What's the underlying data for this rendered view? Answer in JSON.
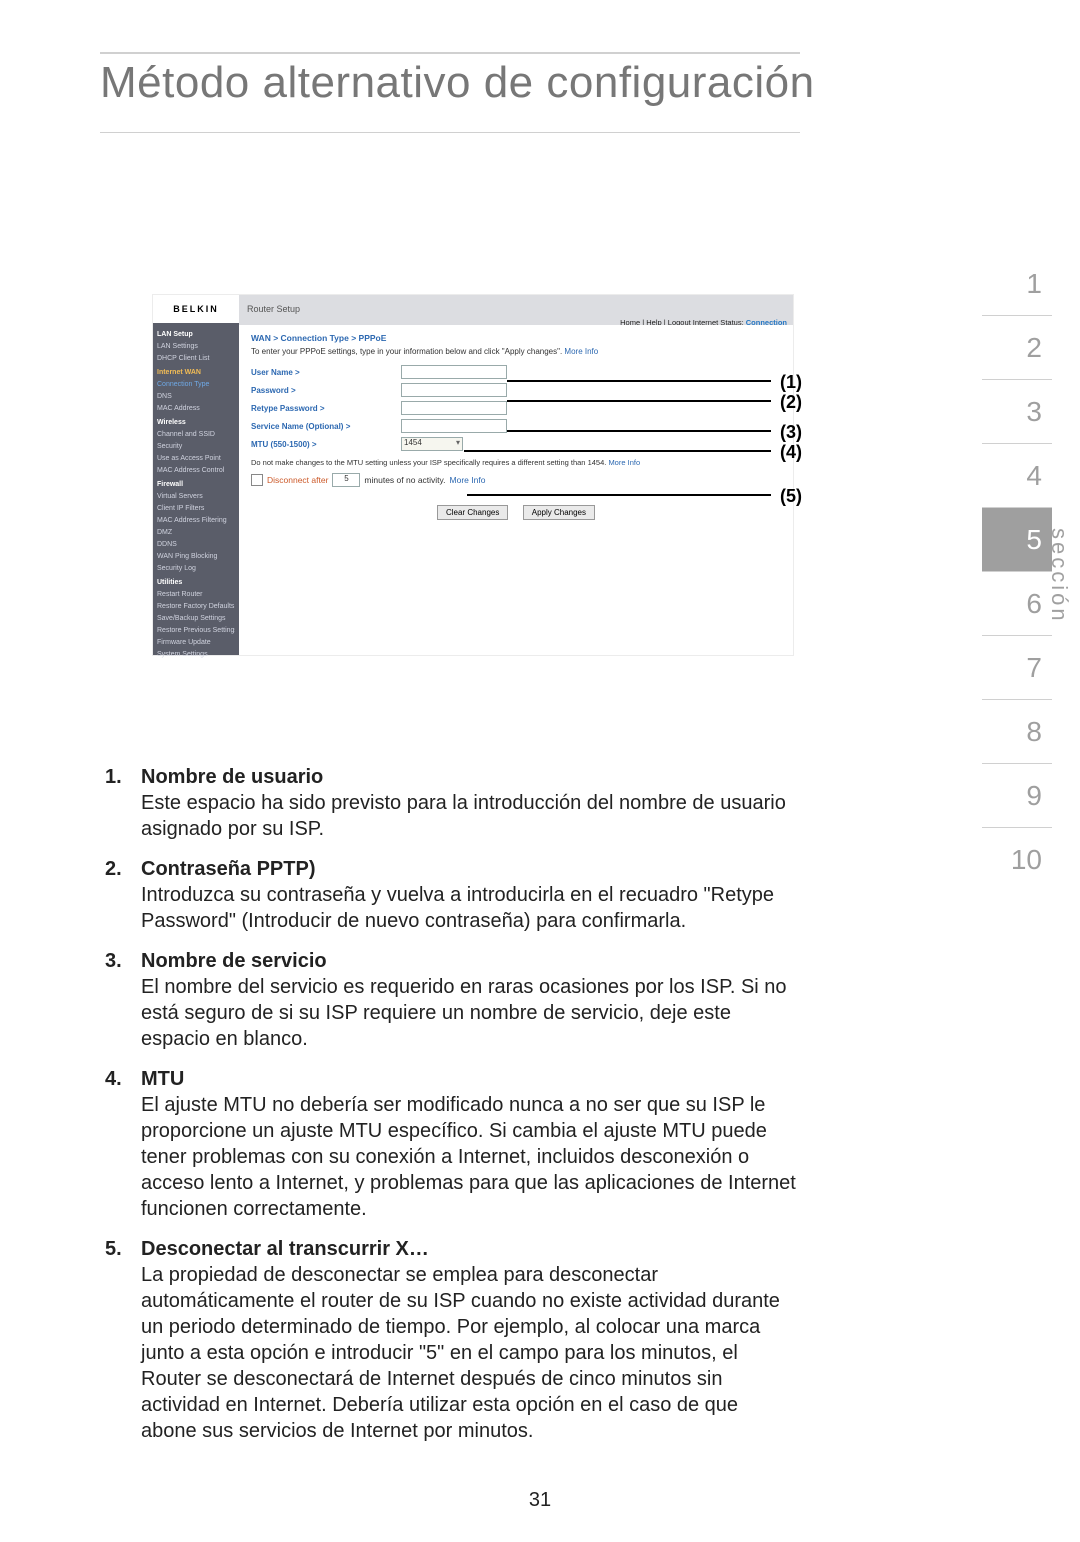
{
  "page": {
    "title": "Método alternativo de configuración",
    "number": "31"
  },
  "section_nav": {
    "items": [
      "1",
      "2",
      "3",
      "4",
      "5",
      "6",
      "7",
      "8",
      "9",
      "10"
    ],
    "current_index": 4,
    "label": "sección"
  },
  "router_ui": {
    "logo": "BELKIN",
    "header_title": "Router Setup",
    "header_links": "Home | Help | Logout   Internet Status: ",
    "internet_status": "Connection",
    "sidebar": {
      "groups": [
        {
          "label": "LAN Setup",
          "cls": "cat",
          "items": [
            "LAN Settings",
            "DHCP Client List"
          ]
        },
        {
          "label": "Internet WAN",
          "cls": "cat hi",
          "items": [
            {
              "t": "Connection Type",
              "cls": "sel"
            },
            "DNS",
            "MAC Address"
          ]
        },
        {
          "label": "Wireless",
          "cls": "cat",
          "items": [
            "Channel and SSID",
            "Security",
            "Use as Access Point",
            "MAC Address Control"
          ]
        },
        {
          "label": "Firewall",
          "cls": "cat",
          "items": [
            "Virtual Servers",
            "Client IP Filters",
            "MAC Address Filtering",
            "DMZ",
            "DDNS",
            "WAN Ping Blocking",
            "Security Log"
          ]
        },
        {
          "label": "Utilities",
          "cls": "cat",
          "items": [
            "Restart Router",
            "Restore Factory Defaults",
            "Save/Backup Settings",
            "Restore Previous Settings",
            "Firmware Update",
            "System Settings"
          ]
        }
      ]
    },
    "content": {
      "breadcrumb": "WAN > Connection Type > PPPoE",
      "intro": "To enter your PPPoE settings, type in your information below and click \"Apply changes\".",
      "more_info": "More Info",
      "mtu_value": "1454",
      "fields": [
        {
          "label": "User Name >"
        },
        {
          "label": "Password >"
        },
        {
          "label": "Retype Password >"
        },
        {
          "label": "Service Name (Optional) >"
        },
        {
          "label": "MTU (550-1500) >",
          "type": "mtu"
        }
      ],
      "mtu_note": "Do not make changes to the MTU setting unless your ISP specifically requires a different setting than 1454.",
      "disconnect_label": "Disconnect after",
      "disconnect_min": "5",
      "disconnect_tail": "minutes of no activity.",
      "btn_clear": "Clear Changes",
      "btn_apply": "Apply Changes"
    },
    "callouts": [
      "(1)",
      "(2)",
      "(3)",
      "(4)",
      "(5)"
    ]
  },
  "list": [
    {
      "n": "1.",
      "h": "Nombre de usuario",
      "t": " Este espacio ha sido previsto para la introducción del nombre de usuario asignado por su ISP."
    },
    {
      "n": "2.",
      "h": "Contraseña PPTP)",
      "t": "Introduzca su contraseña y vuelva a introducirla en el recuadro \"Retype Password\" (Introducir de nuevo contraseña) para confirmarla."
    },
    {
      "n": "3.",
      "h": "Nombre de servicio",
      "t": "El nombre del servicio es requerido en raras ocasiones por los ISP. Si no está seguro de si su ISP requiere un nombre de servicio, deje este espacio en blanco."
    },
    {
      "n": "4.",
      "h": "MTU",
      "t": "El ajuste MTU no debería ser modificado nunca a no ser que su ISP le proporcione un ajuste MTU específico. Si cambia el ajuste MTU puede tener problemas con su conexión a Internet, incluidos desconexión o acceso lento a Internet, y problemas para que las aplicaciones de Internet funcionen correctamente."
    },
    {
      "n": "5.",
      "h": "Desconectar al transcurrir X…",
      "t": "La propiedad de desconectar se emplea para desconectar automáticamente el router de su ISP cuando no existe actividad durante un periodo determinado de tiempo. Por ejemplo, al colocar una marca junto a esta opción e introducir \"5\" en el campo para los minutos, el Router se desconectará de Internet después de cinco minutos sin actividad en Internet. Debería utilizar esta opción en el caso de que abone sus servicios de Internet por minutos."
    }
  ]
}
